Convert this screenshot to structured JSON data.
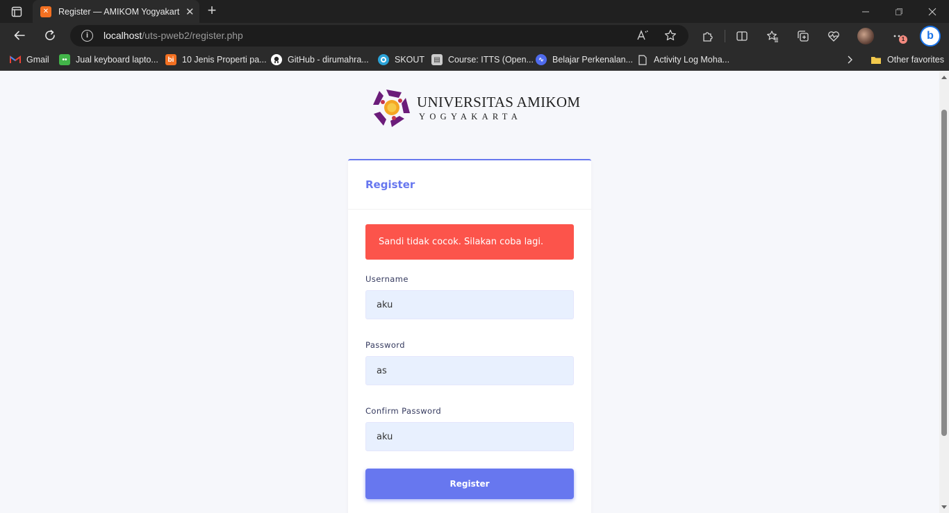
{
  "browser": {
    "tab_title": "Register — AMIKOM Yogyakarta",
    "tab_close": "✕",
    "new_tab": "+",
    "url_host": "localhost",
    "url_path": "/uts-pweb2/register.php",
    "notification_count": "1",
    "bookmarks": [
      {
        "label": "Gmail",
        "icon": "gmail-icon",
        "color": "#ea4335"
      },
      {
        "label": "Jual keyboard lapto...",
        "icon": "tokopedia-icon",
        "color": "#42b549"
      },
      {
        "label": "10 Jenis Properti pa...",
        "icon": "bi-icon",
        "color": "#f37021"
      },
      {
        "label": "GitHub - dirumahra...",
        "icon": "github-icon",
        "color": "#ffffff"
      },
      {
        "label": "SKOUT",
        "icon": "skout-icon",
        "color": "#2ba3d8"
      },
      {
        "label": "Course: ITTS (Open...",
        "icon": "course-icon",
        "color": "#cccccc"
      },
      {
        "label": "Belajar Perkenalan...",
        "icon": "meta-icon",
        "color": "#4f6bed"
      },
      {
        "label": "Activity Log Moha...",
        "icon": "document-icon",
        "color": "#dddddd"
      }
    ],
    "other_favorites": "Other favorites"
  },
  "logo": {
    "title": "UNIVERSITAS AMIKOM",
    "subtitle": "YOGYAKARTA"
  },
  "form": {
    "heading": "Register",
    "alert": "Sandi tidak cocok. Silakan coba lagi.",
    "username_label": "Username",
    "username_value": "aku",
    "password_label": "Password",
    "password_value": "as",
    "confirm_label": "Confirm Password",
    "confirm_value": "aku",
    "submit_label": "Register"
  },
  "colors": {
    "primary": "#6777ef",
    "danger": "#fc544b",
    "input_bg": "#e8f0fe"
  }
}
